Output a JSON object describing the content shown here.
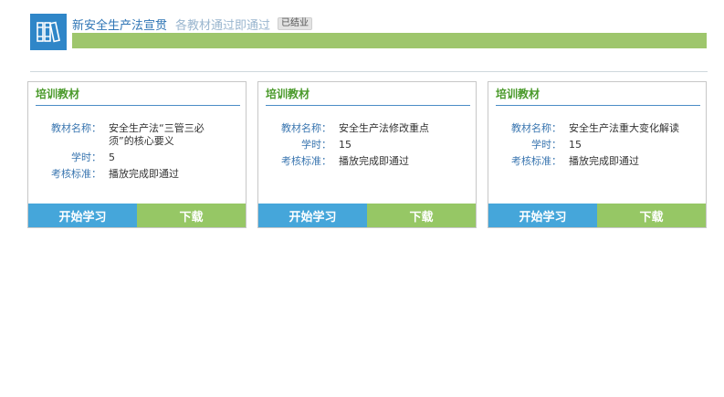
{
  "course": {
    "title": "新安全生产法宣贯",
    "subtitle": "各教材通过即通过",
    "status": "已结业",
    "progress_percent": 100,
    "accent_color": "#2f86c8",
    "progress_color": "#9ec66c"
  },
  "labels": {
    "card_header": "培训教材",
    "material_name": "教材名称：",
    "hours": "学时：",
    "criteria": "考核标准：",
    "start_button": "开始学习",
    "download_button": "下载"
  },
  "materials": [
    {
      "name": "安全生产法“三管三必须”的核心要义",
      "hours": "5",
      "criteria": "播放完成即通过"
    },
    {
      "name": "安全生产法修改重点",
      "hours": "15",
      "criteria": "播放完成即通过"
    },
    {
      "name": "安全生产法重大变化解读",
      "hours": "15",
      "criteria": "播放完成即通过"
    }
  ],
  "icons": {
    "course": "books-icon"
  }
}
